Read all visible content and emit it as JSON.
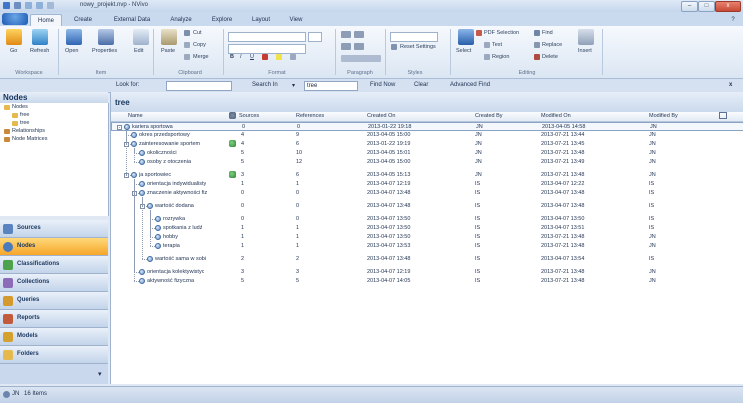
{
  "window": {
    "title": "nowy_projekt.nvp - NVivo",
    "help": "?",
    "close": "x"
  },
  "tabs": [
    "Home",
    "Create",
    "External Data",
    "Analyze",
    "Explore",
    "Layout",
    "View"
  ],
  "ribbon": {
    "workspace": {
      "label": "Workspace",
      "go": "Go",
      "refresh": "Refresh"
    },
    "item": {
      "label": "Item",
      "open": "Open",
      "properties": "Properties",
      "edit": "Edit"
    },
    "clipboard": {
      "label": "Clipboard",
      "paste": "Paste",
      "cut": "Cut",
      "copy": "Copy",
      "merge": "Merge"
    },
    "format": {
      "label": "Format",
      "bold": "B",
      "italic": "I",
      "underline": "U"
    },
    "paragraph": {
      "label": "Paragraph"
    },
    "styles": {
      "label": "Styles",
      "reset": "Reset Settings"
    },
    "editing": {
      "label": "Editing",
      "select": "Select",
      "pdf_selection": "PDF Selection",
      "text": "Text",
      "region": "Region",
      "find": "Find",
      "replace": "Replace",
      "delete": "Delete",
      "insert": "Insert"
    }
  },
  "findbar": {
    "look_for": "Look for:",
    "search_in": "Search In",
    "search_value": "tree",
    "find_now": "Find Now",
    "clear": "Clear",
    "advanced": "Advanced Find",
    "close": "x"
  },
  "nav": {
    "title": "Nodes",
    "tree": [
      "Nodes",
      "free",
      "tree",
      "Relationships",
      "Node Matrices"
    ],
    "buttons": [
      "Sources",
      "Nodes",
      "Classifications",
      "Collections",
      "Queries",
      "Reports",
      "Models",
      "Folders"
    ]
  },
  "content": {
    "title": "tree",
    "columns": [
      "Name",
      "Sources",
      "References",
      "Created On",
      "Created By",
      "Modified On",
      "Modified By"
    ],
    "rows": [
      {
        "name": "kariera sportowa",
        "level": 0,
        "expander": "-",
        "sources": "0",
        "refs": "0",
        "created": "2013-01-22 19:18",
        "cby": "JN",
        "modified": "2013-04-05 14:58",
        "mby": "JN",
        "sel": true
      },
      {
        "name": "okres przedsportowy",
        "level": 1,
        "expander": "",
        "sources": "4",
        "refs": "9",
        "created": "2013-04-05 15:00",
        "cby": "JN",
        "modified": "2013-07-21 13:44",
        "mby": "JN"
      },
      {
        "name": "zainteresowanie sportem",
        "level": 1,
        "expander": "-",
        "coding": true,
        "sources": "4",
        "refs": "6",
        "created": "2013-01-22 19:19",
        "cby": "JN",
        "modified": "2013-07-21 13:45",
        "mby": "JN"
      },
      {
        "name": "okoliczności",
        "level": 2,
        "expander": "",
        "sources": "5",
        "refs": "10",
        "created": "2013-04-05 15:01",
        "cby": "JN",
        "modified": "2013-07-21 13:48",
        "mby": "JN"
      },
      {
        "name": "osoby z otoczenia",
        "level": 2,
        "expander": "",
        "sources": "5",
        "refs": "12",
        "created": "2013-04-05 15:00",
        "cby": "JN",
        "modified": "2013-07-21 13:49",
        "mby": "JN"
      },
      {
        "name": "ja sportowiec",
        "level": 1,
        "expander": "-",
        "coding": true,
        "sources": "3",
        "refs": "6",
        "created": "2013-04-05 15:13",
        "cby": "JN",
        "modified": "2013-07-21 13:48",
        "mby": "JN",
        "gap": true
      },
      {
        "name": "orientacja indywidualisty",
        "level": 2,
        "expander": "",
        "sources": "1",
        "refs": "1",
        "created": "2013-04-07 12:19",
        "cby": "IS",
        "modified": "2013-04-07 12:22",
        "mby": "IS"
      },
      {
        "name": "znaczenie aktywności fiz",
        "level": 2,
        "expander": "-",
        "sources": "0",
        "refs": "0",
        "created": "2013-04-07 13:48",
        "cby": "IS",
        "modified": "2013-04-07 13:48",
        "mby": "IS"
      },
      {
        "name": "wartość dodana",
        "level": 3,
        "expander": "-",
        "sources": "0",
        "refs": "0",
        "created": "2013-04-07 13:48",
        "cby": "IS",
        "modified": "2013-04-07 13:48",
        "mby": "IS",
        "gap": true
      },
      {
        "name": "rozrywka",
        "level": 4,
        "expander": "",
        "sources": "0",
        "refs": "0",
        "created": "2013-04-07 13:50",
        "cby": "IS",
        "modified": "2013-04-07 13:50",
        "mby": "IS",
        "gap": true
      },
      {
        "name": "spotkania z ludź",
        "level": 4,
        "expander": "",
        "sources": "1",
        "refs": "1",
        "created": "2013-04-07 13:50",
        "cby": "IS",
        "modified": "2013-04-07 13:51",
        "mby": "IS"
      },
      {
        "name": "hobby",
        "level": 4,
        "expander": "",
        "sources": "1",
        "refs": "1",
        "created": "2013-04-07 13:50",
        "cby": "IS",
        "modified": "2013-07-21 13:48",
        "mby": "JN"
      },
      {
        "name": "terapia",
        "level": 4,
        "expander": "",
        "sources": "1",
        "refs": "1",
        "created": "2013-04-07 13:53",
        "cby": "IS",
        "modified": "2013-07-21 13:48",
        "mby": "JN"
      },
      {
        "name": "wartość sama w sobi",
        "level": 3,
        "expander": "",
        "sources": "2",
        "refs": "2",
        "created": "2013-04-07 13:48",
        "cby": "IS",
        "modified": "2013-04-07 13:54",
        "mby": "IS",
        "gap": true
      },
      {
        "name": "orientacja kolektywistyc",
        "level": 2,
        "expander": "",
        "sources": "3",
        "refs": "3",
        "created": "2013-04-07 12:19",
        "cby": "IS",
        "modified": "2013-07-21 13:48",
        "mby": "JN",
        "gap": true
      },
      {
        "name": "aktywność fizyczna",
        "level": 2,
        "expander": "",
        "sources": "5",
        "refs": "5",
        "created": "2013-04-07 14:05",
        "cby": "IS",
        "modified": "2013-07-21 13:48",
        "mby": "JN"
      }
    ]
  },
  "status": {
    "user": "JN",
    "items": "16 Items"
  }
}
